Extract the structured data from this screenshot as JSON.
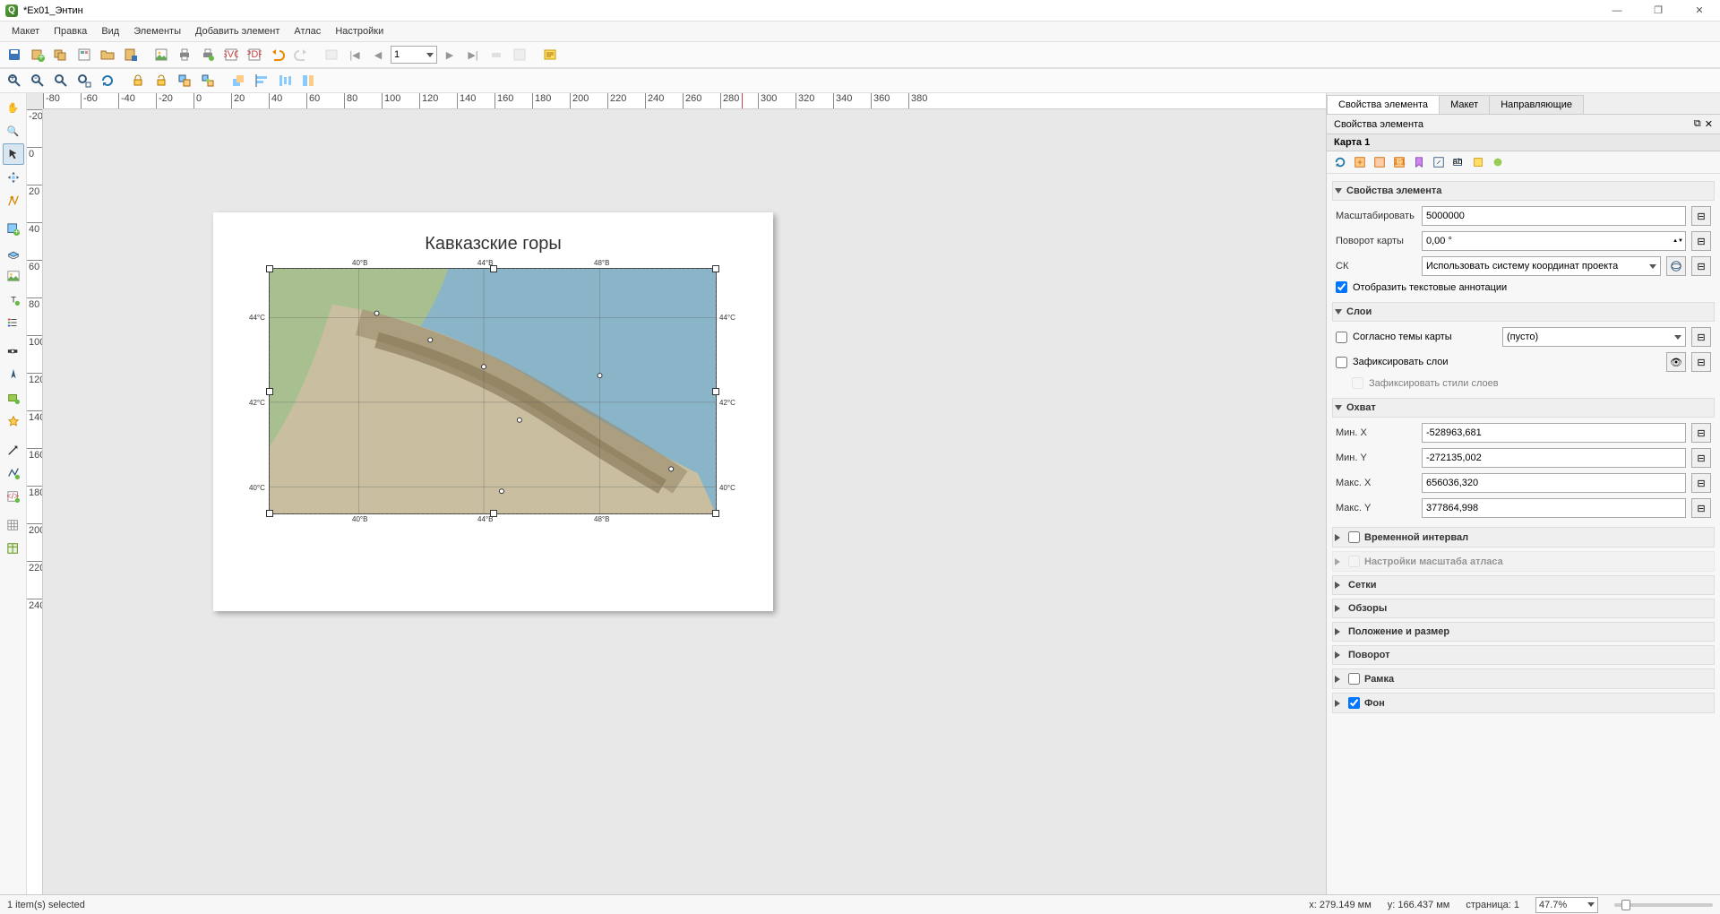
{
  "window": {
    "title": "*Ex01_Энтин"
  },
  "menu": [
    "Макет",
    "Правка",
    "Вид",
    "Элементы",
    "Добавить элемент",
    "Атлас",
    "Настройки"
  ],
  "toolbar1": {
    "page_number": "1"
  },
  "canvas": {
    "map_title": "Кавказские горы",
    "lon_labels_top": [
      "40°В",
      "44°В",
      "48°В"
    ],
    "lon_labels_bottom": [
      "40°В",
      "44°В",
      "48°В"
    ],
    "lat_labels_left": [
      "44°С",
      "42°С",
      "40°С"
    ],
    "lat_labels_right": [
      "44°С",
      "42°С",
      "40°С"
    ]
  },
  "tabs": [
    "Свойства элемента",
    "Макет",
    "Направляющие"
  ],
  "panel": {
    "title": "Свойства элемента",
    "item_name": "Карта 1",
    "sections": {
      "main": {
        "label": "Свойства элемента",
        "scale_label": "Масштабировать",
        "scale_value": "5000000",
        "rotation_label": "Поворот карты",
        "rotation_value": "0,00 °",
        "crs_label": "СК",
        "crs_value": "Использовать систему координат проекта",
        "draw_annot_label": "Отобразить текстовые аннотации",
        "draw_annot_checked": true
      },
      "layers": {
        "label": "Слои",
        "follow_theme_label": "Согласно темы карты",
        "theme_value": "(пусто)",
        "lock_layers_label": "Зафиксировать слои",
        "lock_styles_label": "Зафиксировать стили слоев"
      },
      "extent": {
        "label": "Охват",
        "minx_label": "Мин. X",
        "minx_value": "-528963,681",
        "miny_label": "Мин. Y",
        "miny_value": "-272135,002",
        "maxx_label": "Макс. X",
        "maxx_value": "656036,320",
        "maxy_label": "Макс. Y",
        "maxy_value": "377864,998"
      },
      "temporal": {
        "label": "Временной интервал"
      },
      "atlas": {
        "label": "Настройки масштаба атласа"
      },
      "grids": {
        "label": "Сетки"
      },
      "overviews": {
        "label": "Обзоры"
      },
      "position": {
        "label": "Положение и размер"
      },
      "rotation": {
        "label": "Поворот"
      },
      "frame": {
        "label": "Рамка"
      },
      "background": {
        "label": "Фон",
        "checked": true
      }
    }
  },
  "status": {
    "selection": "1 item(s) selected",
    "x_label": "x: 279.149 мм",
    "y_label": "y: 166.437 мм",
    "page_label": "страница: 1",
    "zoom": "47.7%"
  },
  "ruler": {
    "h_ticks": [
      "-80",
      "-60",
      "-40",
      "-20",
      "0",
      "20",
      "40",
      "60",
      "80",
      "100",
      "120",
      "140",
      "160",
      "180",
      "200",
      "220",
      "240",
      "260",
      "280",
      "300",
      "320",
      "340",
      "360",
      "380"
    ],
    "v_ticks": [
      "-20",
      "0",
      "20",
      "40",
      "60",
      "80",
      "100",
      "120",
      "140",
      "160",
      "180",
      "200",
      "220",
      "240"
    ]
  }
}
